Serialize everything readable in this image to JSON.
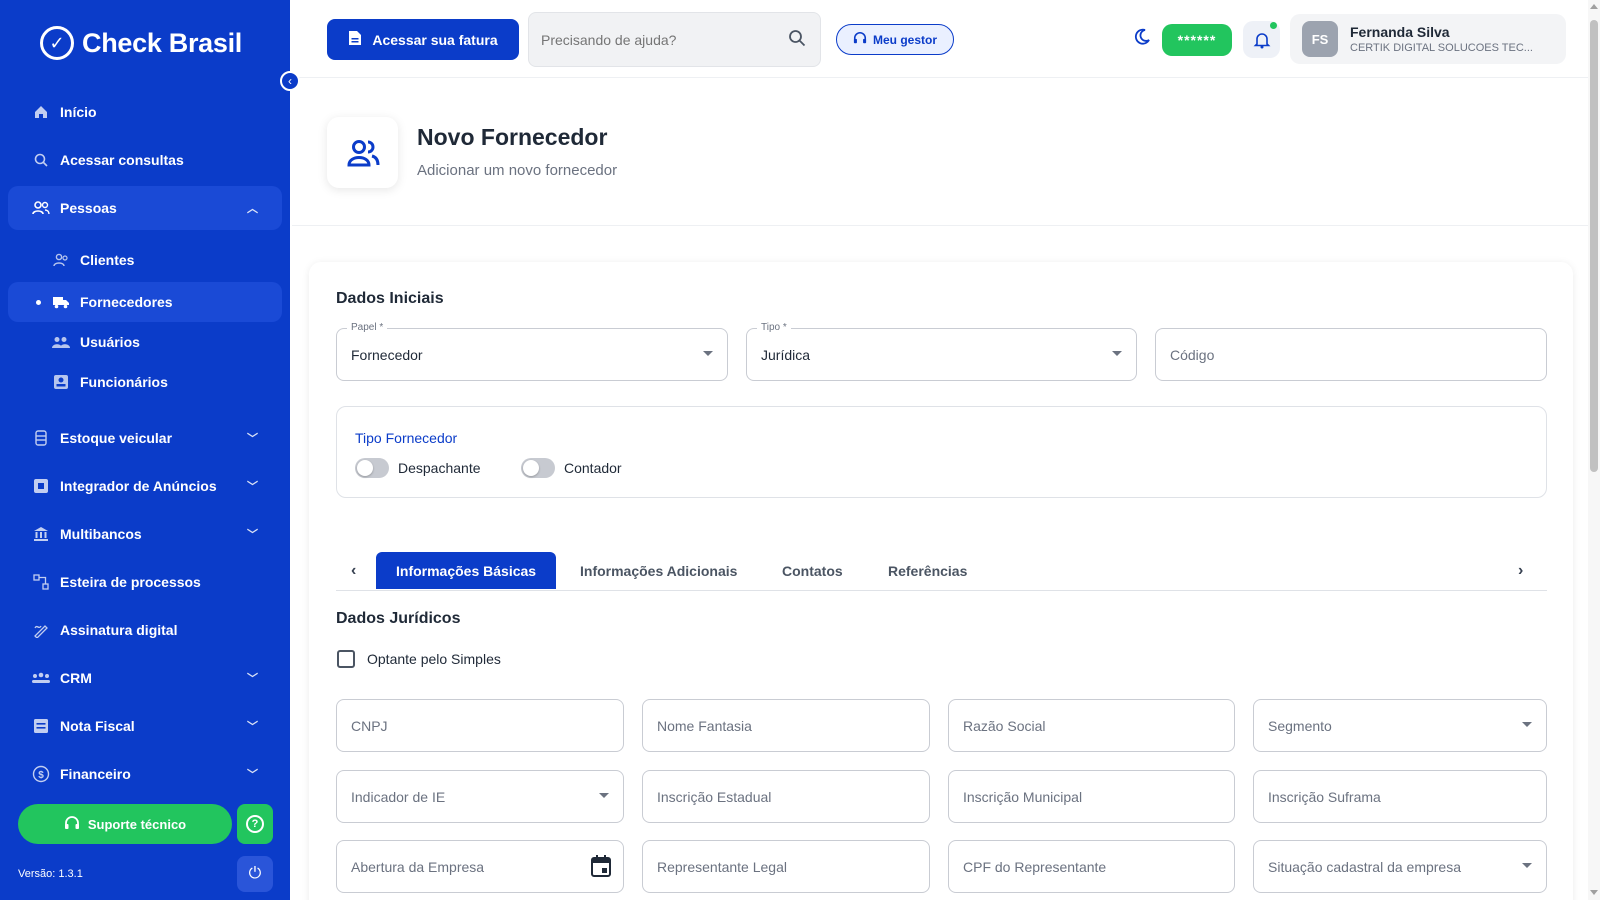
{
  "brand": {
    "name": "Check Brasil",
    "primary": "#0b3cc9",
    "green": "#22c55e"
  },
  "sidebar": {
    "items": [
      {
        "key": "inicio",
        "label": "Início",
        "icon": "home-icon"
      },
      {
        "key": "consultas",
        "label": "Acessar consultas",
        "icon": "search-icon"
      },
      {
        "key": "pessoas",
        "label": "Pessoas",
        "icon": "people-icon",
        "expanded": true,
        "children": [
          {
            "label": "Clientes",
            "icon": "users-icon"
          },
          {
            "label": "Fornecedores",
            "icon": "truck-icon",
            "active": true
          },
          {
            "label": "Usuários",
            "icon": "group-icon"
          },
          {
            "label": "Funcionários",
            "icon": "badge-icon"
          }
        ]
      },
      {
        "key": "estoque",
        "label": "Estoque veicular",
        "icon": "car-icon"
      },
      {
        "key": "integrador",
        "label": "Integrador de Anúncios",
        "icon": "megaphone-icon"
      },
      {
        "key": "multibancos",
        "label": "Multibancos",
        "icon": "bank-icon"
      },
      {
        "key": "esteira",
        "label": "Esteira de processos",
        "icon": "flow-icon"
      },
      {
        "key": "assinatura",
        "label": "Assinatura digital",
        "icon": "signature-icon"
      },
      {
        "key": "crm",
        "label": "CRM",
        "icon": "crm-icon"
      },
      {
        "key": "nota",
        "label": "Nota Fiscal",
        "icon": "invoice-icon"
      },
      {
        "key": "financeiro",
        "label": "Financeiro",
        "icon": "money-icon"
      }
    ],
    "support_label": "Suporte técnico",
    "version": "Versão: 1.3.1"
  },
  "header": {
    "fatura_label": "Acessar sua fatura",
    "search_placeholder": "Precisando de ajuda?",
    "gestor_label": "Meu gestor",
    "masked_balance": "******",
    "user": {
      "initials": "FS",
      "name": "Fernanda Silva",
      "company": "CERTIK DIGITAL SOLUCOES TEC..."
    }
  },
  "page": {
    "title": "Novo Fornecedor",
    "subtitle": "Adicionar um novo fornecedor"
  },
  "form": {
    "dados_iniciais": "Dados Iniciais",
    "papel": {
      "label": "Papel *",
      "value": "Fornecedor"
    },
    "tipo": {
      "label": "Tipo *",
      "value": "Jurídica"
    },
    "codigo_placeholder": "Código",
    "tipo_fornecedor": "Tipo Fornecedor",
    "toggles": [
      {
        "label": "Despachante",
        "on": false
      },
      {
        "label": "Contador",
        "on": false
      }
    ],
    "tabs": [
      "Informações Básicas",
      "Informações Adicionais",
      "Contatos",
      "Referências"
    ],
    "active_tab": 0,
    "dados_juridicos": "Dados Jurídicos",
    "optante": "Optante pelo Simples",
    "fields": {
      "cnpj": "CNPJ",
      "nome_fantasia": "Nome Fantasia",
      "razao_social": "Razão Social",
      "segmento": "Segmento",
      "indicador_ie": "Indicador de IE",
      "inscricao_estadual": "Inscrição Estadual",
      "inscricao_municipal": "Inscrição Municipal",
      "inscricao_suframa": "Inscrição Suframa",
      "abertura": "Abertura da Empresa",
      "representante": "Representante Legal",
      "cpf_representante": "CPF do Representante",
      "situacao": "Situação cadastral da empresa"
    }
  }
}
